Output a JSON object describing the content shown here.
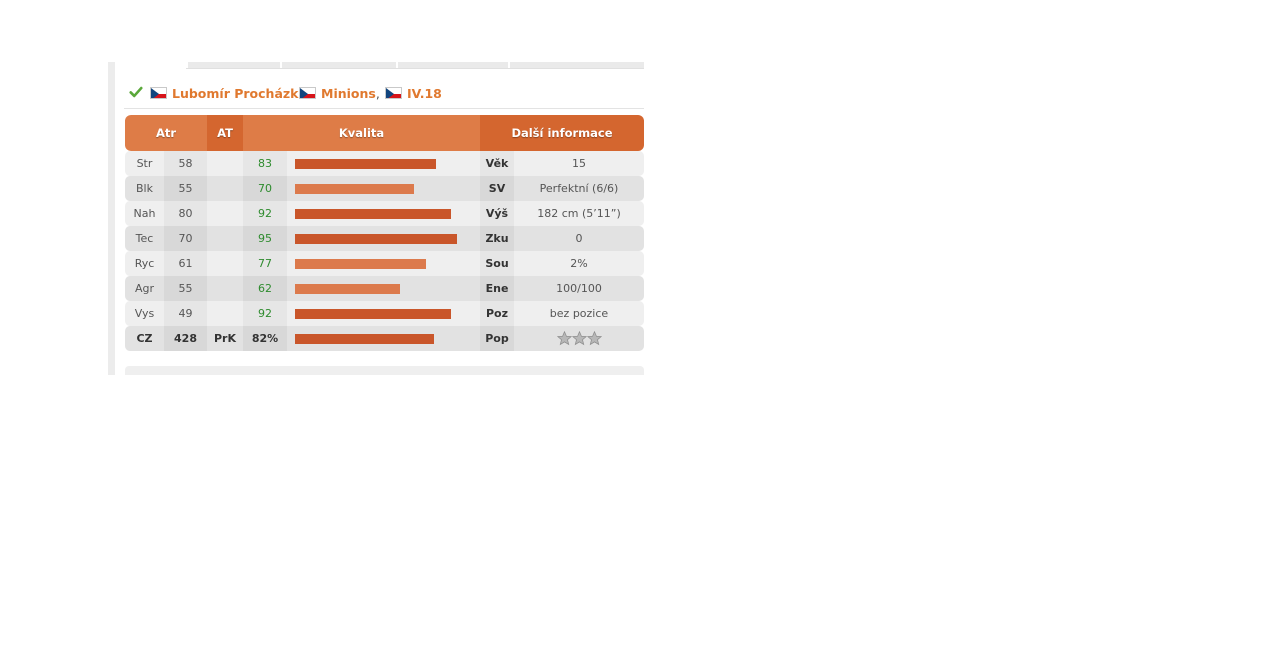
{
  "player": {
    "name": "Lubomír Procházka",
    "team": "Minions",
    "comma": ",",
    "league": "IV.18",
    "flag_country": "cz"
  },
  "table": {
    "headers": {
      "atr": "Atr",
      "at": "AT",
      "kvalita": "Kvalita",
      "info": "Další informace"
    },
    "rows": [
      {
        "atr": "Str",
        "val": "58",
        "at": "",
        "q": "83",
        "q_pct": 83,
        "info_label": "Věk",
        "info_value": "15"
      },
      {
        "atr": "Blk",
        "val": "55",
        "at": "",
        "q": "70",
        "q_pct": 70,
        "info_label": "SV",
        "info_value": "Perfektní (6/6)"
      },
      {
        "atr": "Nah",
        "val": "80",
        "at": "",
        "q": "92",
        "q_pct": 92,
        "info_label": "Výš",
        "info_value": "182 cm (5’11”)"
      },
      {
        "atr": "Tec",
        "val": "70",
        "at": "",
        "q": "95",
        "q_pct": 95,
        "info_label": "Zku",
        "info_value": "0"
      },
      {
        "atr": "Ryc",
        "val": "61",
        "at": "",
        "q": "77",
        "q_pct": 77,
        "info_label": "Sou",
        "info_value": "2%"
      },
      {
        "atr": "Agr",
        "val": "55",
        "at": "",
        "q": "62",
        "q_pct": 62,
        "info_label": "Ene",
        "info_value": "100/100"
      },
      {
        "atr": "Vys",
        "val": "49",
        "at": "",
        "q": "92",
        "q_pct": 92,
        "info_label": "Poz",
        "info_value": "bez pozice"
      }
    ],
    "total": {
      "atr": "CZ",
      "val": "428",
      "at": "PrK",
      "q": "82%",
      "q_pct": 82,
      "info_label": "Pop",
      "stars_filled": 0,
      "stars_total": 3
    }
  },
  "colors": {
    "accent": "#e0792f",
    "header": "#de7c47",
    "header_dark": "#d4662f",
    "bar": "#c9562a",
    "bar_light": "#dc7a4c",
    "quality_text": "#2e8b2e"
  }
}
